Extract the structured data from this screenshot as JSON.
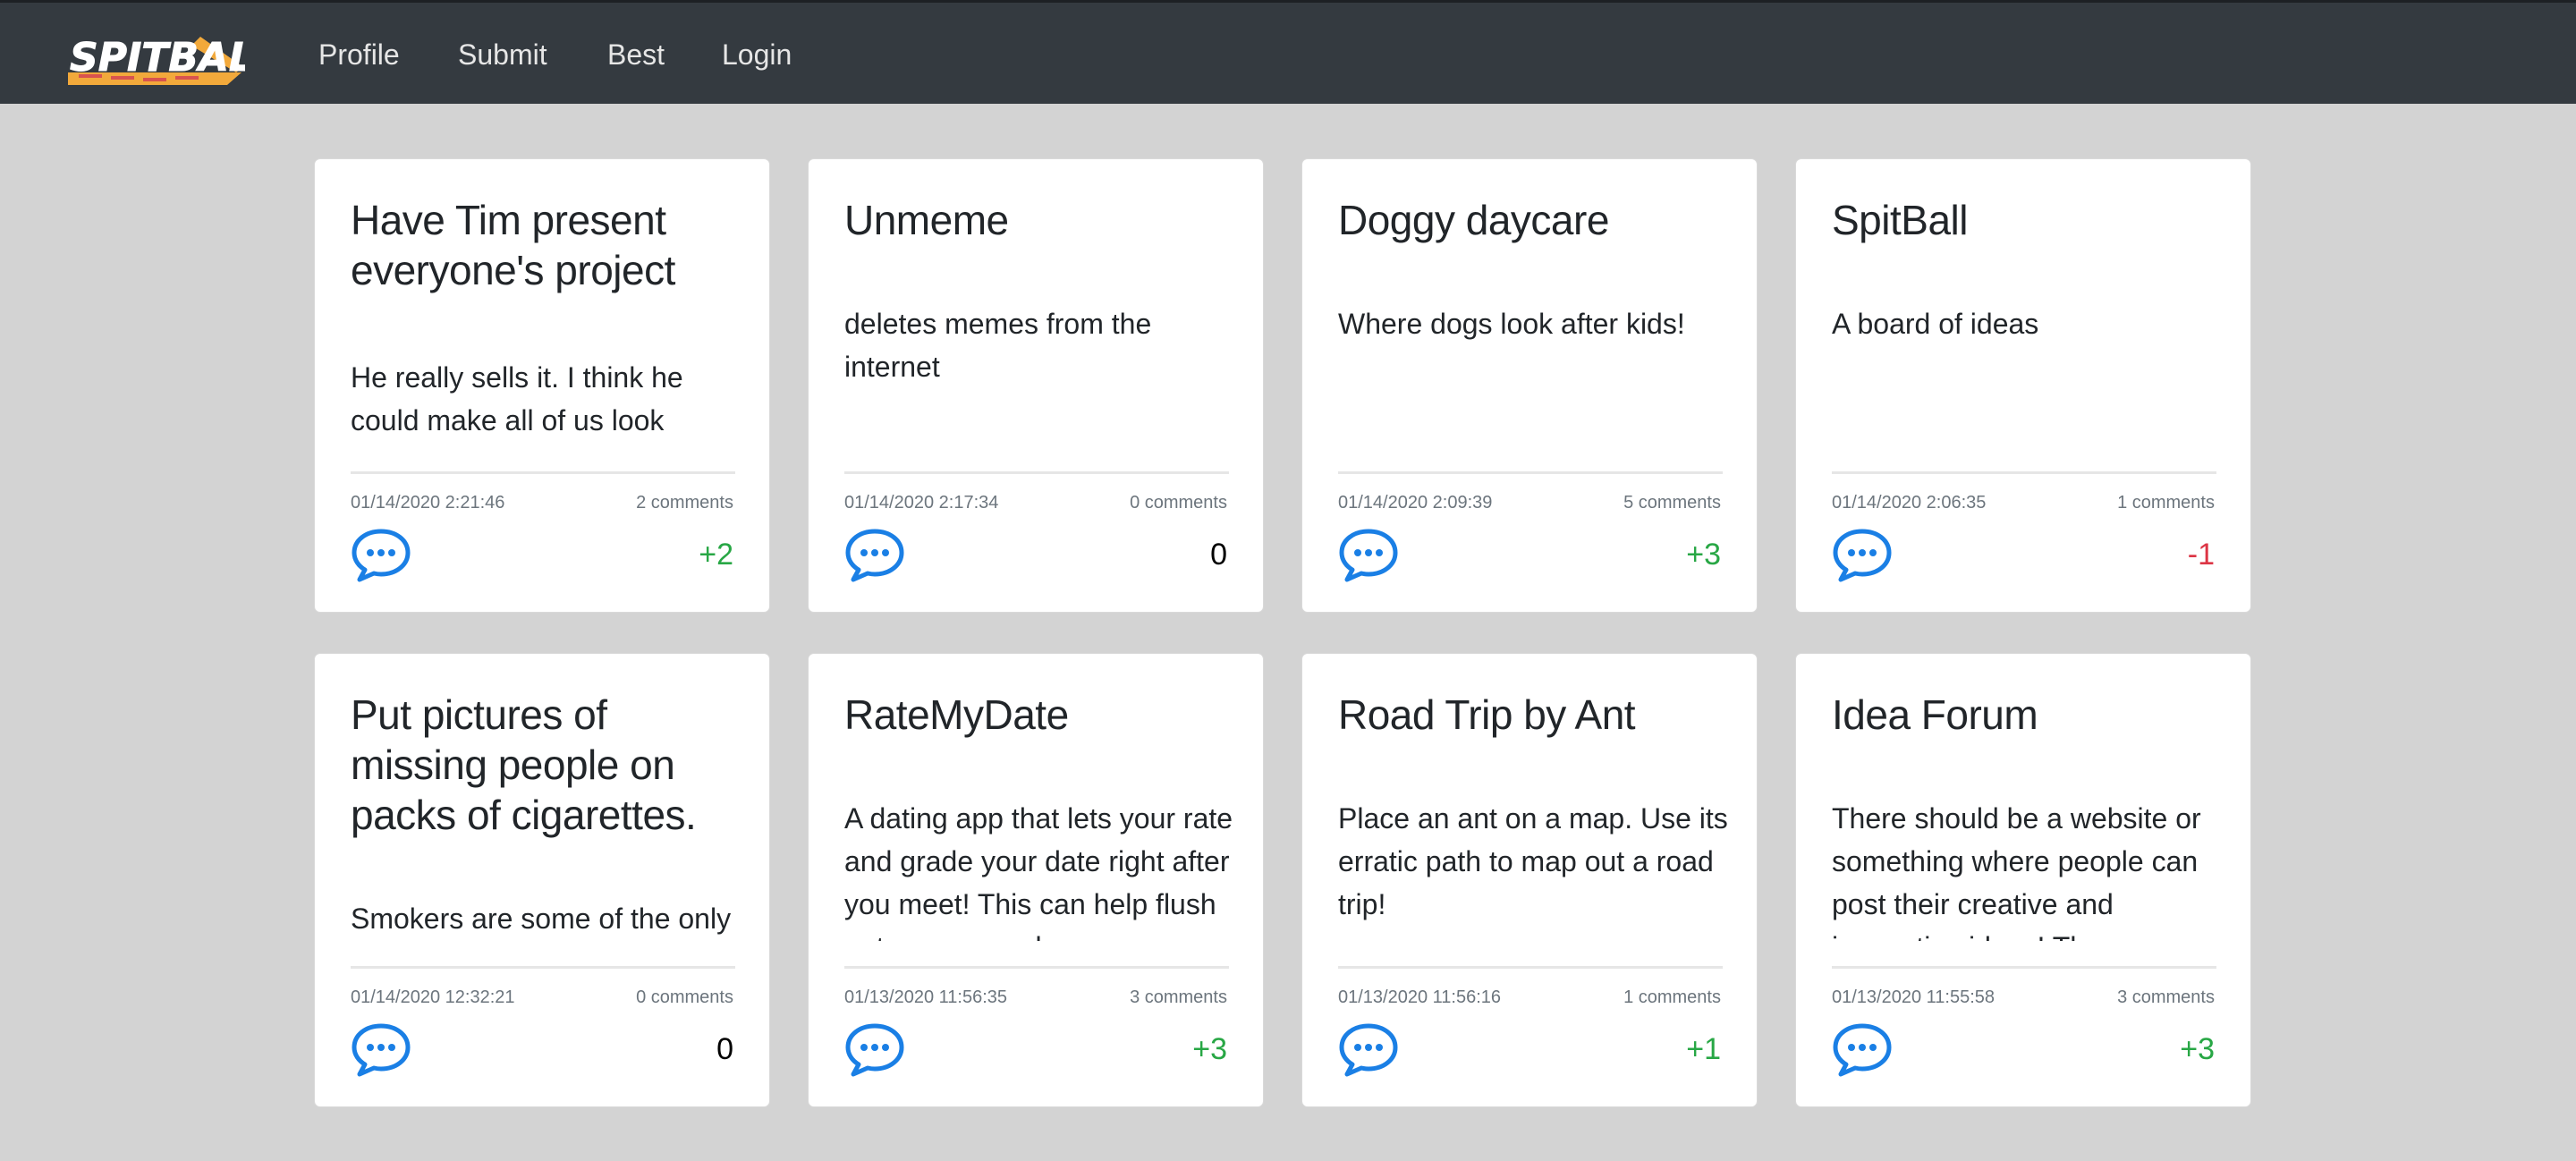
{
  "brand": {
    "logo_text": "SPITBALL"
  },
  "nav": [
    "Profile",
    "Submit",
    "Best",
    "Login"
  ],
  "colors": {
    "positive": "#28a745",
    "negative": "#dc3545",
    "neutral": "#000000",
    "icon": "#1a7fe5"
  },
  "cards": [
    {
      "title": "Have Tim present everyone's project",
      "body": "He really sells it. I think he could make all of us look sexier.",
      "date": "01/14/2020 2:21:46",
      "comments": "2 comments",
      "score": "+2",
      "score_color": "#28a745",
      "icon": "speech-bubble-icon"
    },
    {
      "title": "Unmeme",
      "body": "deletes memes from the internet",
      "date": "01/14/2020 2:17:34",
      "comments": "0 comments",
      "score": "0",
      "score_color": "#000000",
      "icon": "speech-bubble-icon"
    },
    {
      "title": "Doggy daycare",
      "body": "Where dogs look after kids!",
      "date": "01/14/2020 2:09:39",
      "comments": "5 comments",
      "score": "+3",
      "score_color": "#28a745",
      "icon": "speech-bubble-icon"
    },
    {
      "title": "SpitBall",
      "body": "A board of ideas",
      "date": "01/14/2020 2:06:35",
      "comments": "1 comments",
      "score": "-1",
      "score_color": "#dc3545",
      "icon": "speech-bubble-icon"
    },
    {
      "title": "Put pictures of missing people on packs of cigarettes.",
      "body": "Smokers are some of the only people who will stand",
      "date": "01/14/2020 12:32:21",
      "comments": "0 comments",
      "score": "0",
      "score_color": "#000000",
      "icon": "speech-bubble-icon"
    },
    {
      "title": "RateMyDate",
      "body": "A dating app that lets your rate and grade your date right after you meet! This can help flush out mean people",
      "date": "01/13/2020 11:56:35",
      "comments": "3 comments",
      "score": "+3",
      "score_color": "#28a745",
      "icon": "speech-bubble-icon"
    },
    {
      "title": "Road Trip by Ant",
      "body": "Place an ant on a map. Use its erratic path to map out a road trip!",
      "date": "01/13/2020 11:56:16",
      "comments": "1 comments",
      "score": "+1",
      "score_color": "#28a745",
      "icon": "speech-bubble-icon"
    },
    {
      "title": "Idea Forum",
      "body": "There should be a website or something where people can post their creative and innovative ideas! There",
      "date": "01/13/2020 11:55:58",
      "comments": "3 comments",
      "score": "+3",
      "score_color": "#28a745",
      "icon": "speech-bubble-icon"
    }
  ]
}
